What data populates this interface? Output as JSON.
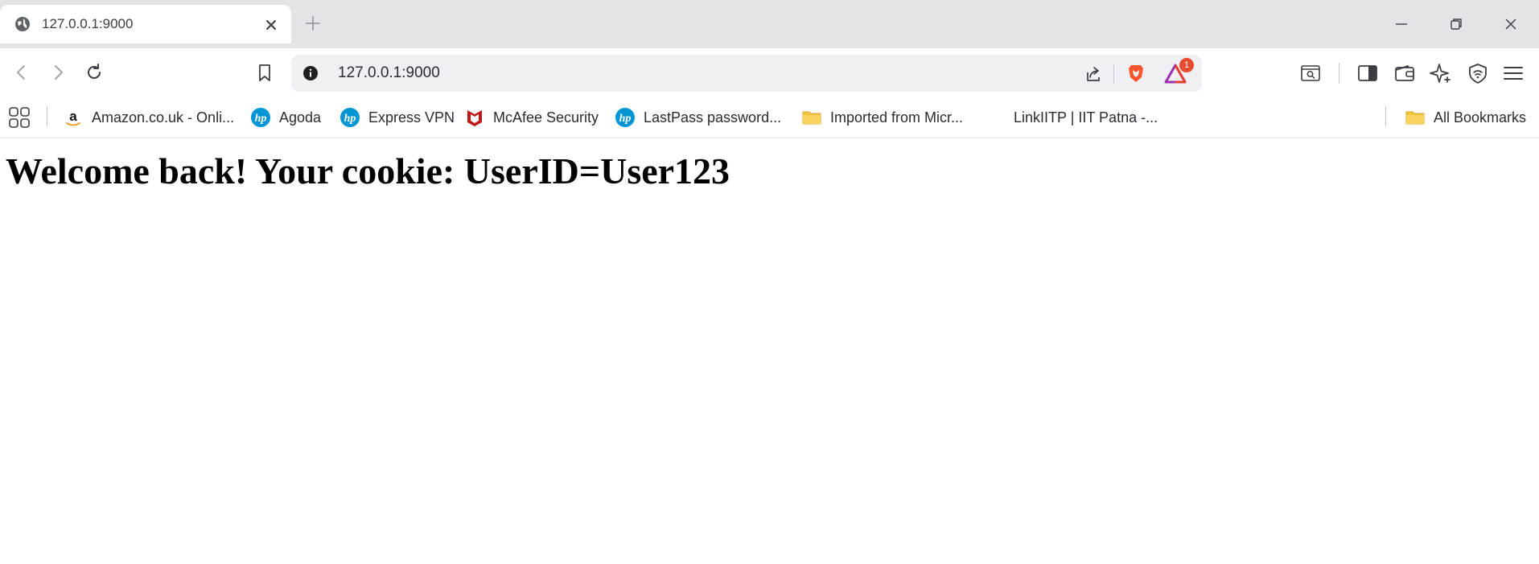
{
  "tab": {
    "title": "127.0.0.1:9000"
  },
  "address_bar": {
    "url": "127.0.0.1:9000",
    "rewards_badge": "1"
  },
  "bookmarks": {
    "items": [
      {
        "label": "Amazon.co.uk - Onli...",
        "icon": "amazon-icon"
      },
      {
        "label": "Agoda",
        "icon": "hp-icon"
      },
      {
        "label": "Express VPN",
        "icon": "hp-icon"
      },
      {
        "label": "McAfee Security",
        "icon": "mcafee-icon"
      },
      {
        "label": "LastPass password...",
        "icon": "hp-icon"
      },
      {
        "label": "Imported from Micr...",
        "icon": "folder-icon"
      },
      {
        "label": "LinkIITP | IIT Patna -...",
        "icon": "none"
      }
    ],
    "all_bookmarks": "All Bookmarks"
  },
  "page": {
    "heading": "Welcome back! Your cookie: UserID=User123"
  },
  "colors": {
    "tabstrip": "#e3e3e8",
    "omnibox": "#f0f0f4",
    "brave_orange": "#fb542b",
    "hp_blue": "#0096d6",
    "mcafee_red": "#c01818",
    "folder_yellow": "#f4c542"
  }
}
